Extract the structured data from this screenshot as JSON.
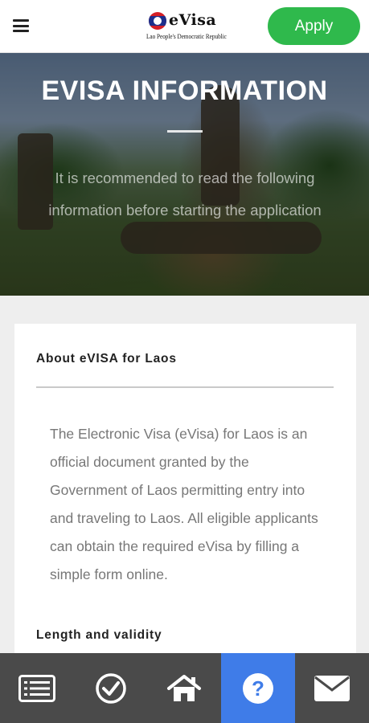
{
  "header": {
    "logo_text": "eVisa",
    "logo_subtitle": "Lao People's Democratic Republic",
    "apply_label": "Apply"
  },
  "hero": {
    "title": "EVISA INFORMATION",
    "description": "It is recommended to read the following information before starting the application"
  },
  "content": {
    "section1_title": "About eVISA for Laos",
    "section1_body": "The Electronic Visa (eVisa) for Laos is an official document granted by the Government of Laos permitting entry into and traveling to Laos. All eligible applicants can obtain the required eVisa by filling a simple form online.",
    "section2_title": "Length and validity"
  },
  "tabbar": {
    "active_tab": "help",
    "icons": [
      "list-icon",
      "check-circle-icon",
      "home-icon",
      "question-icon",
      "mail-icon"
    ],
    "active_color": "#3f7ce8"
  },
  "colors": {
    "apply": "#2fb94c",
    "tabbar": "#4a4a4a"
  }
}
